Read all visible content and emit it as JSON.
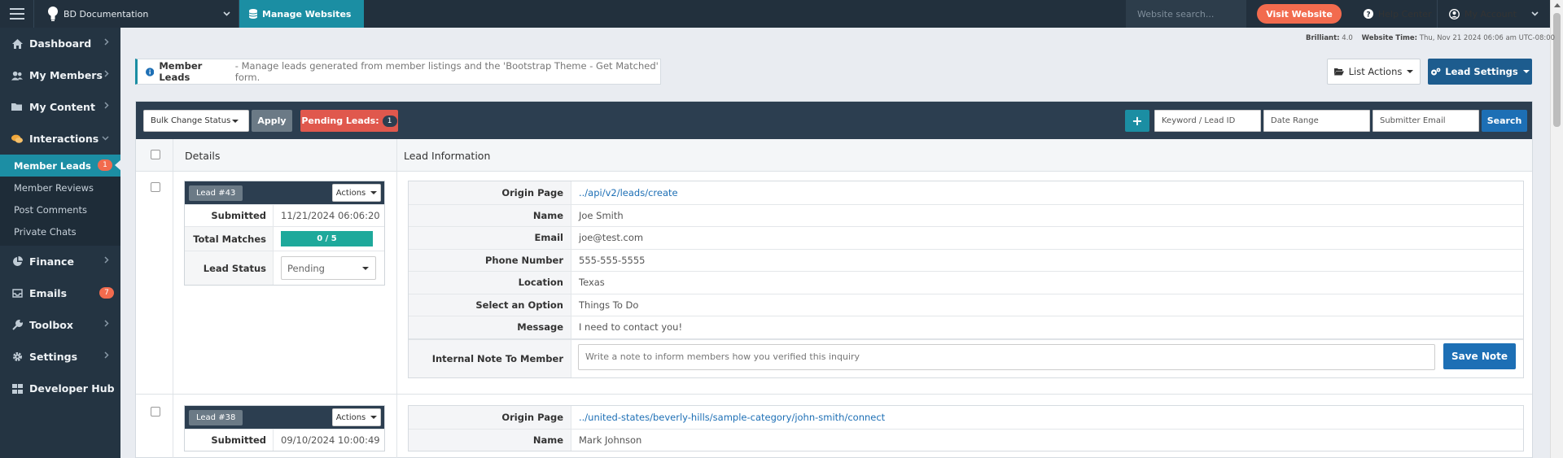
{
  "topbar": {
    "brand_name": "BD Documentation",
    "manage_label": "Manage Websites",
    "search_placeholder": "Website search...",
    "visit_label": "Visit Website",
    "help_label": "Help Center",
    "account_label": "My Account"
  },
  "colors": {
    "topbar": "#22303d",
    "sidebar": "#243442",
    "accent_teal": "#1b8ea3",
    "accent_orange": "#f26b4e",
    "primary_blue": "#1d6fb5"
  },
  "sidebar": {
    "items": [
      {
        "label": "Dashboard",
        "icon": "home-icon"
      },
      {
        "label": "My Members",
        "icon": "users-icon"
      },
      {
        "label": "My Content",
        "icon": "folder-icon"
      },
      {
        "label": "Interactions",
        "icon": "comments-icon"
      }
    ],
    "submenu": [
      {
        "label": "Member Leads",
        "badge": "1",
        "active": true
      },
      {
        "label": "Member Reviews"
      },
      {
        "label": "Post Comments"
      },
      {
        "label": "Private Chats"
      }
    ],
    "items_after": [
      {
        "label": "Finance",
        "icon": "pie-chart-icon"
      },
      {
        "label": "Emails",
        "icon": "inbox-icon",
        "badge": "7"
      },
      {
        "label": "Toolbox",
        "icon": "wrench-icon"
      },
      {
        "label": "Settings",
        "icon": "gear-icon"
      },
      {
        "label": "Developer Hub",
        "icon": "grid-icon"
      }
    ]
  },
  "meta": {
    "brilliant_label": "Brilliant:",
    "brilliant_value": "4.0",
    "time_label": "Website Time:",
    "time_value": "Thu, Nov 21 2024 06:06 am UTC-08:00"
  },
  "notice": {
    "title": "Member Leads",
    "description": "- Manage leads generated from member listings and the 'Bootstrap Theme - Get Matched' form."
  },
  "header_buttons": {
    "list_actions": "List Actions",
    "lead_settings": "Lead Settings"
  },
  "toolbar": {
    "bulk_label": "Bulk Change Status",
    "apply_label": "Apply",
    "pending_label": "Pending Leads:",
    "pending_count": "1",
    "add_label": "+",
    "keyword_placeholder": "Keyword / Lead ID",
    "date_placeholder": "Date Range",
    "email_placeholder": "Submitter Email",
    "search_label": "Search"
  },
  "table": {
    "col_details": "Details",
    "col_info": "Lead Information"
  },
  "leads": [
    {
      "id_label": "Lead #43",
      "actions_label": "Actions",
      "submitted_key": "Submitted",
      "submitted": "11/21/2024 06:06:20",
      "matches_key": "Total Matches",
      "matches": "0 / 5",
      "status_key": "Lead Status",
      "status": "Pending",
      "info": [
        {
          "key": "Origin Page",
          "value": "../api/v2/leads/create",
          "link": true
        },
        {
          "key": "Name",
          "value": "Joe Smith"
        },
        {
          "key": "Email",
          "value": "joe@test.com"
        },
        {
          "key": "Phone Number",
          "value": "555-555-5555"
        },
        {
          "key": "Location",
          "value": "Texas"
        },
        {
          "key": "Select an Option",
          "value": "Things To Do"
        },
        {
          "key": "Message",
          "value": "I need to contact you!"
        }
      ],
      "note_key": "Internal Note To Member",
      "note_placeholder": "Write a note to inform members how you verified this inquiry",
      "save_label": "Save Note"
    },
    {
      "id_label": "Lead #38",
      "actions_label": "Actions",
      "submitted_key": "Submitted",
      "submitted": "09/10/2024 10:00:49",
      "info": [
        {
          "key": "Origin Page",
          "value": "../united-states/beverly-hills/sample-category/john-smith/connect",
          "link": true
        },
        {
          "key": "Name",
          "value": "Mark Johnson"
        }
      ]
    }
  ]
}
